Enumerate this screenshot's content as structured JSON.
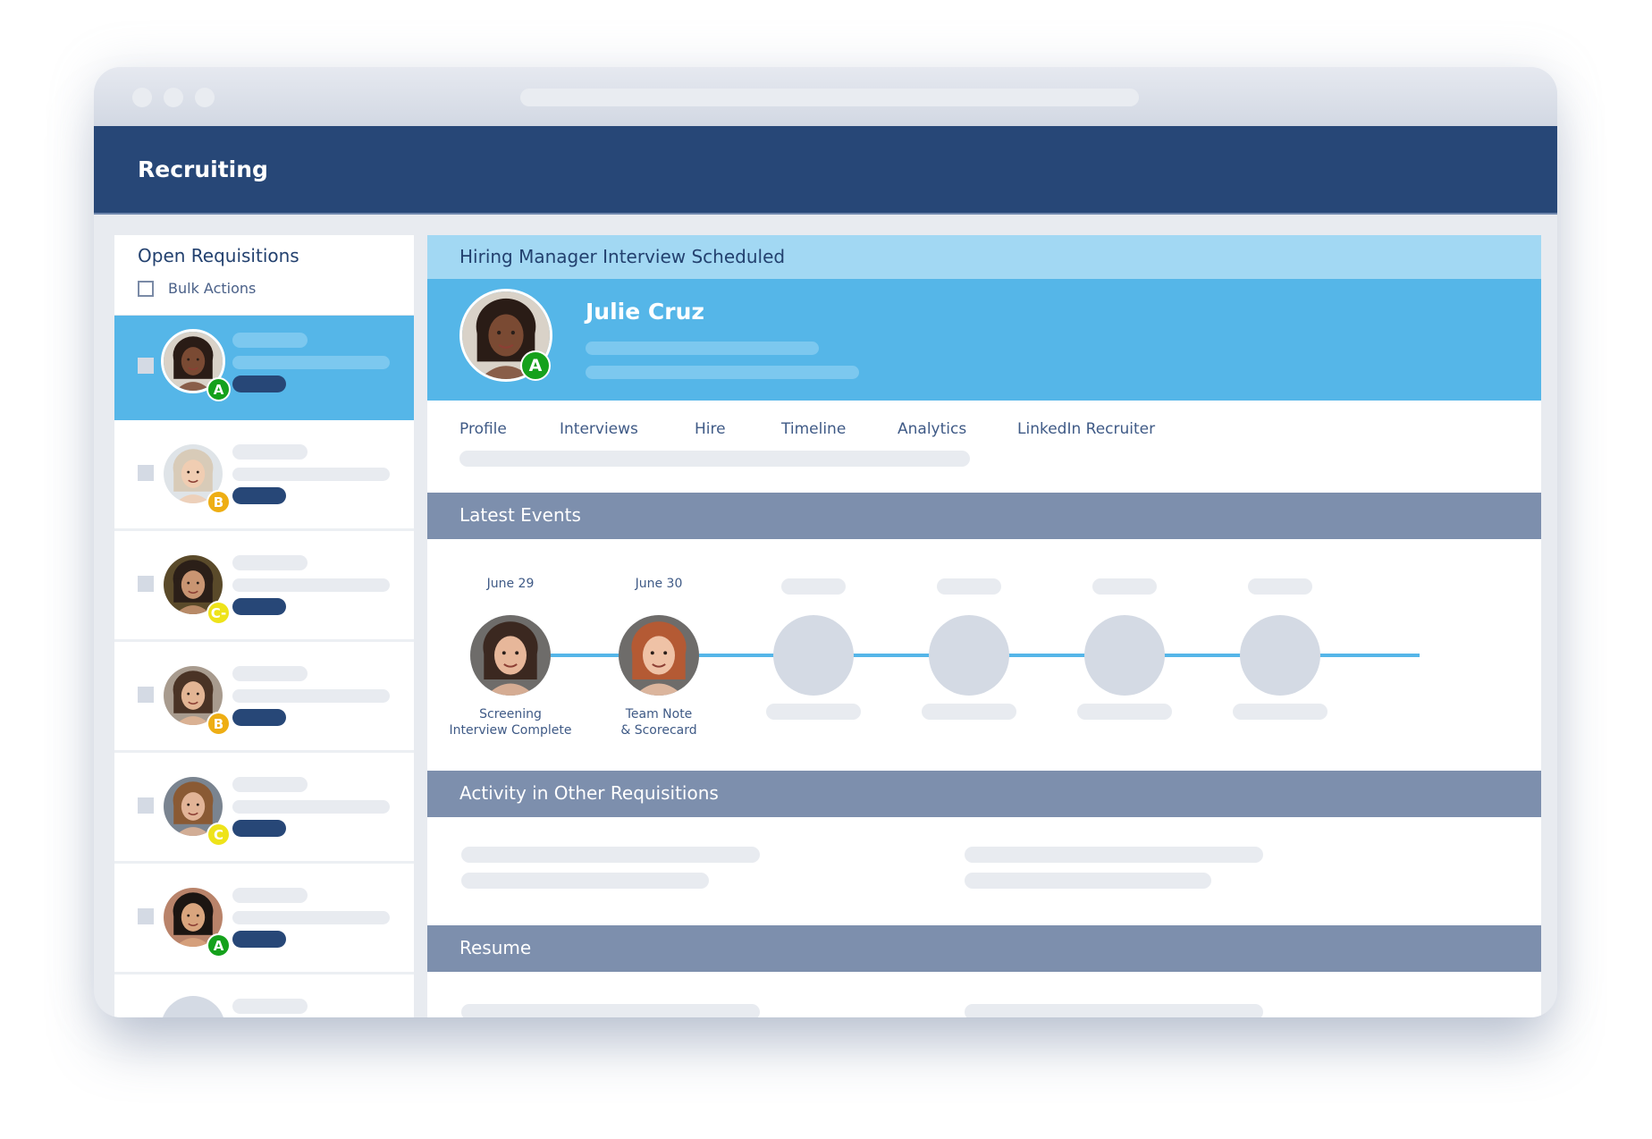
{
  "app": {
    "title": "Recruiting"
  },
  "sidebar": {
    "heading": "Open Requisitions",
    "bulk_actions_label": "Bulk Actions",
    "candidates": [
      {
        "grade": "A",
        "grade_color": "#15a11c",
        "selected": true,
        "skin": "#7a4a33",
        "hair": "#2a1c16",
        "bg": "#d9d2c8"
      },
      {
        "grade": "B",
        "grade_color": "#eeae14",
        "selected": false,
        "skin": "#f0cdb2",
        "hair": "#d8cbb8",
        "bg": "#dfe4e8"
      },
      {
        "grade": "C-",
        "grade_color": "#eee31a",
        "selected": false,
        "skin": "#c99572",
        "hair": "#2b1f18",
        "bg": "#5a4a2a"
      },
      {
        "grade": "B",
        "grade_color": "#eeae14",
        "selected": false,
        "skin": "#e3b594",
        "hair": "#4a3325",
        "bg": "#a89b8e"
      },
      {
        "grade": "C",
        "grade_color": "#eee31a",
        "selected": false,
        "skin": "#e2b497",
        "hair": "#8a5a34",
        "bg": "#7a8490"
      },
      {
        "grade": "A",
        "grade_color": "#15a11c",
        "selected": false,
        "skin": "#d9a57e",
        "hair": "#1c1512",
        "bg": "#b9836a"
      }
    ]
  },
  "main": {
    "status": "Hiring Manager Interview Scheduled",
    "candidate": {
      "name": "Julie Cruz",
      "grade": "A",
      "grade_color": "#15a11c"
    },
    "tabs": [
      "Profile",
      "Interviews",
      "Hire",
      "Timeline",
      "Analytics",
      "LinkedIn Recruiter"
    ],
    "sections": {
      "latest_events": "Latest Events",
      "activity": "Activity in Other Requisitions",
      "resume": "Resume"
    },
    "events": [
      {
        "date": "June 29",
        "label_line1": "Screening",
        "label_line2": "Interview Complete",
        "skin": "#e7b79a",
        "hair": "#3b2820"
      },
      {
        "date": "June 30",
        "label_line1": "Team Note",
        "label_line2": "& Scorecard",
        "skin": "#efc2a6",
        "hair": "#b45a34"
      },
      {
        "placeholder": true
      },
      {
        "placeholder": true
      },
      {
        "placeholder": true
      },
      {
        "placeholder": true
      }
    ]
  },
  "colors": {
    "navy": "#274777",
    "sky": "#55b6e8",
    "sky_light": "#a2d8f3",
    "section_bar": "#7d8fad",
    "timeline_line": "#55b6e8",
    "placeholder": "#e8ebf0"
  }
}
